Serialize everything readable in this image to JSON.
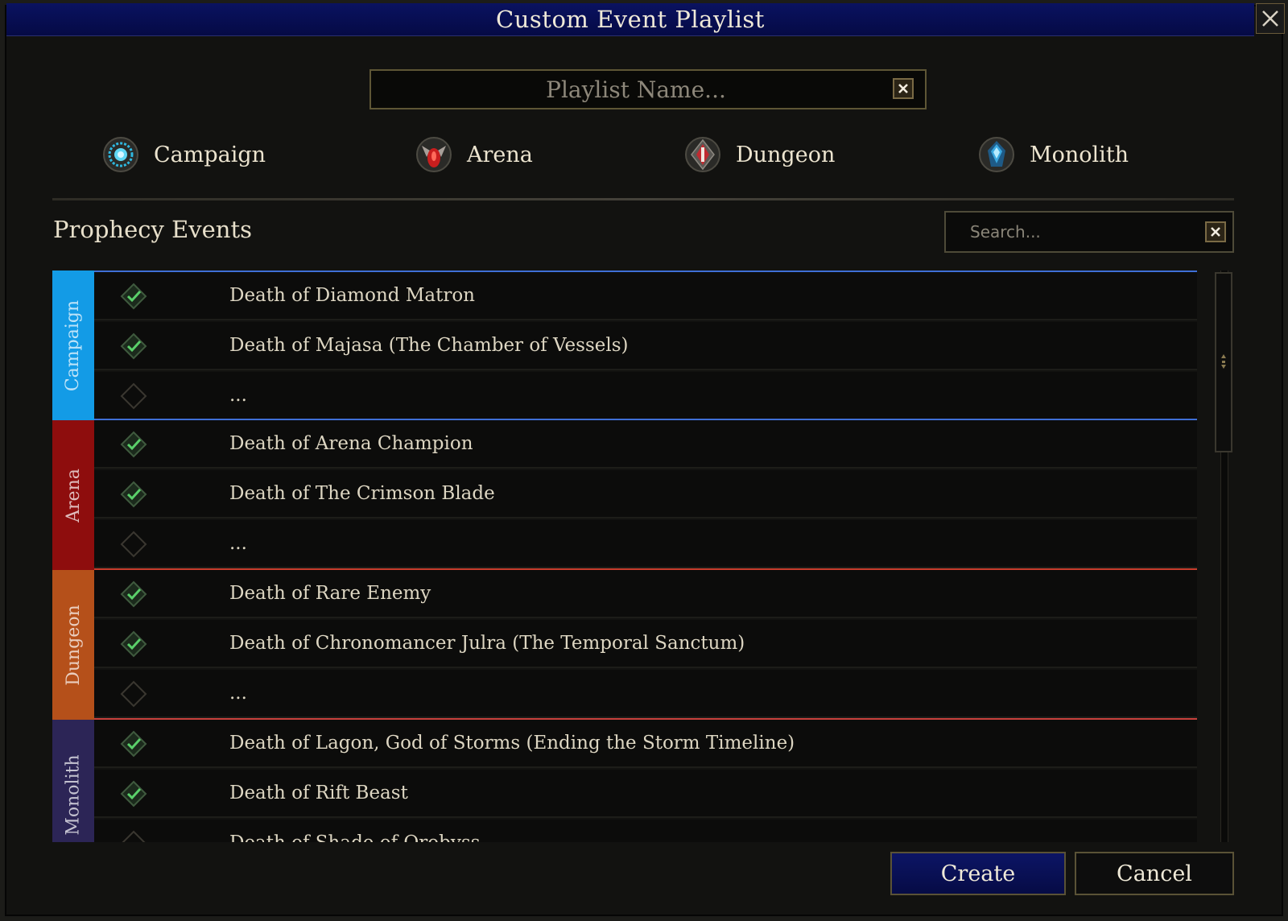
{
  "window": {
    "title": "Custom Event Playlist"
  },
  "playlist": {
    "name_value": "",
    "placeholder": "Playlist Name..."
  },
  "types": [
    {
      "label": "Campaign",
      "icon": "campaign-emblem-icon",
      "color": "#2fb8e0"
    },
    {
      "label": "Arena",
      "icon": "arena-emblem-icon",
      "color": "#c81e1e"
    },
    {
      "label": "Dungeon",
      "icon": "dungeon-emblem-icon",
      "color": "#c02a30"
    },
    {
      "label": "Monolith",
      "icon": "monolith-emblem-icon",
      "color": "#3aa8e0"
    }
  ],
  "section": {
    "title": "Prophecy Events"
  },
  "search": {
    "value": "",
    "placeholder": "Search..."
  },
  "groups": [
    {
      "label": "Campaign",
      "color": "#139be6",
      "edge": "#3f6fd6",
      "rows": [
        {
          "text": "Death of Diamond Matron",
          "checked": true
        },
        {
          "text": "Death of Majasa (The Chamber of Vessels)",
          "checked": true
        },
        {
          "text": "...",
          "checked": false
        }
      ]
    },
    {
      "label": "Arena",
      "color": "#8e0d0d",
      "edge": "#c83c2c",
      "rows": [
        {
          "text": "Death of Arena Champion",
          "checked": true
        },
        {
          "text": "Death of The Crimson Blade",
          "checked": true
        },
        {
          "text": "...",
          "checked": false
        }
      ]
    },
    {
      "label": "Dungeon",
      "color": "#b5501a",
      "edge": "#c8403c",
      "rows": [
        {
          "text": "Death of Rare Enemy",
          "checked": true
        },
        {
          "text": "Death of Chronomancer Julra (The Temporal Sanctum)",
          "checked": true
        },
        {
          "text": "...",
          "checked": false
        }
      ]
    },
    {
      "label": "Monolith",
      "color": "#2c2556",
      "edge": "#3b3466",
      "rows": [
        {
          "text": "Death of Lagon, God of Storms (Ending the Storm Timeline)",
          "checked": true
        },
        {
          "text": "Death of Rift Beast",
          "checked": true
        },
        {
          "text": "Death of Shade of Orobyss",
          "checked": false
        }
      ]
    }
  ],
  "buttons": {
    "create": "Create",
    "cancel": "Cancel"
  }
}
